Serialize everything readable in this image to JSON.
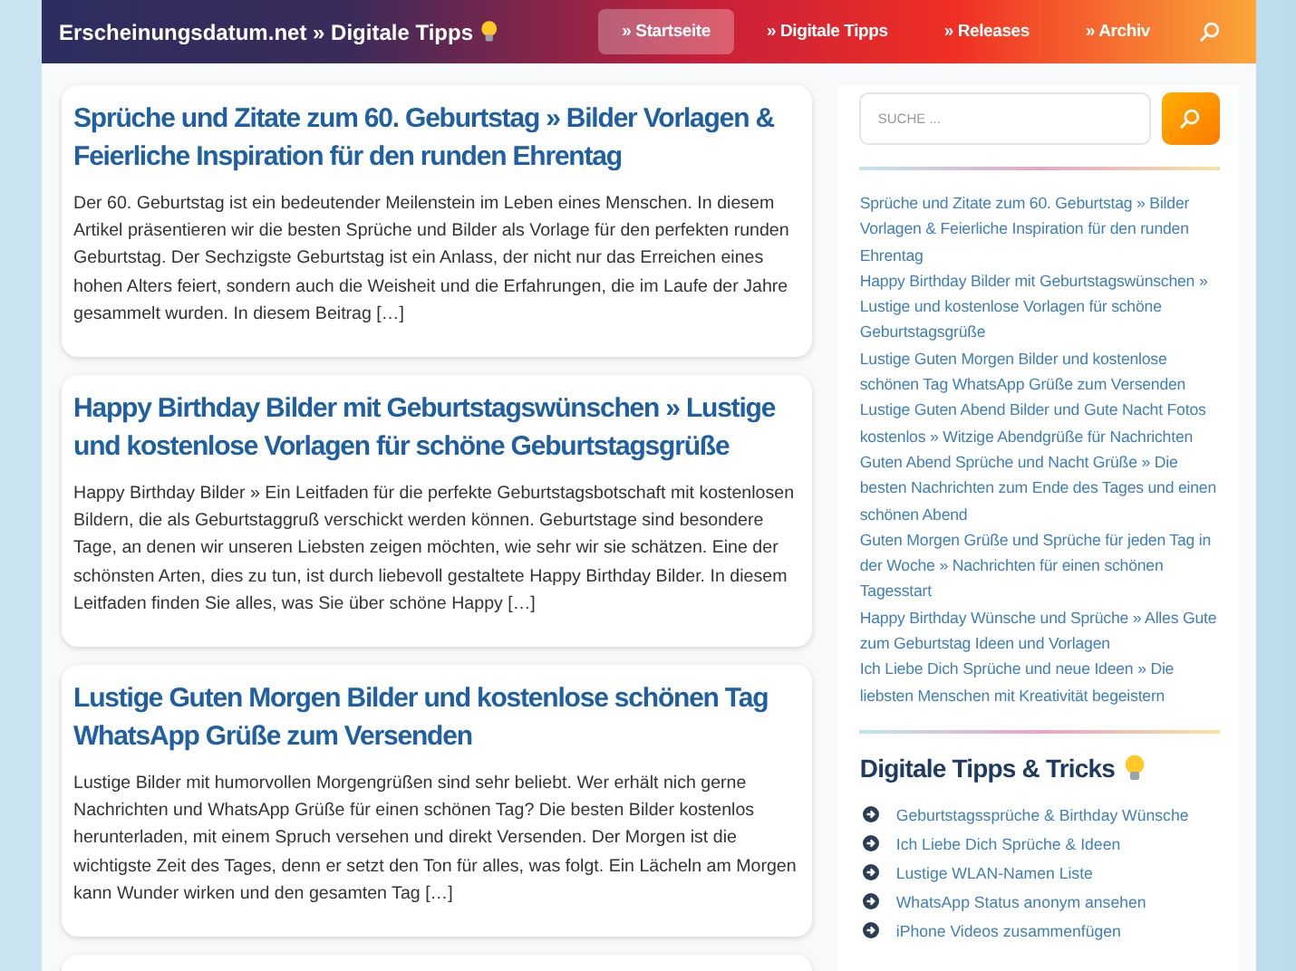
{
  "header": {
    "site_title": "Erscheinungsdatum.net » Digitale Tipps",
    "nav": [
      {
        "label": "» Startseite",
        "selected": true
      },
      {
        "label": "» Digitale Tipps",
        "selected": false
      },
      {
        "label": "» Releases",
        "selected": false
      },
      {
        "label": "» Archiv",
        "selected": false
      }
    ]
  },
  "posts": [
    {
      "title": "Sprüche und Zitate zum 60. Geburtstag » Bilder Vorlagen & Feierliche Inspiration für den runden Ehrentag",
      "excerpt": "Der 60. Geburtstag ist ein bedeutender Meilenstein im Leben eines Menschen. In diesem Artikel präsentieren wir die besten Sprüche und Bilder als Vorlage für den perfekten runden Geburtstag. Der Sechzigste Geburtstag ist ein Anlass, der nicht nur das Erreichen eines hohen Alters feiert, sondern auch die Weisheit und die Erfahrungen, die im Laufe der Jahre gesammelt wurden. In diesem Beitrag […]"
    },
    {
      "title": "Happy Birthday Bilder mit Geburtstagswünschen » Lustige und kostenlose Vorlagen für schöne Geburtstagsgrüße",
      "excerpt": "Happy Birthday Bilder » Ein Leitfaden für die perfekte Geburtstagsbotschaft mit kostenlosen Bildern, die als Geburtstaggruß verschickt werden können. Geburtstage sind besondere Tage, an denen wir unseren Liebsten zeigen möchten, wie sehr wir sie schätzen. Eine der schönsten Arten, dies zu tun, ist durch liebevoll gestaltete Happy Birthday Bilder. In diesem Leitfaden finden Sie alles, was Sie über schöne Happy […]"
    },
    {
      "title": "Lustige Guten Morgen Bilder und kostenlose schönen Tag WhatsApp Grüße zum Versenden",
      "excerpt": "Lustige Bilder mit humorvollen Morgengrüßen sind sehr beliebt. Wer erhält nich gerne Nachrichten und WhatsApp Grüße für einen schönen Tag? Die besten Bilder kostenlos herunterladen, mit einem Spruch versehen und direkt Versenden. Der Morgen ist die wichtigste Zeit des Tages, denn er setzt den Ton für alles, was folgt. Ein Lächeln am Morgen kann Wunder wirken und den gesamten Tag […]"
    }
  ],
  "sidebar": {
    "search": {
      "placeholder": "SUCHE ..."
    },
    "recent_posts": [
      "Sprüche und Zitate zum 60. Geburtstag » Bilder Vorlagen & Feierliche Inspiration für den runden Ehrentag",
      "Happy Birthday Bilder mit Geburtstagswünschen » Lustige und kostenlose Vorlagen für schöne Geburtstagsgrüße",
      "Lustige Guten Morgen Bilder und kostenlose schönen Tag WhatsApp Grüße zum Versenden",
      "Lustige Guten Abend Bilder und Gute Nacht Fotos kostenlos » Witzige Abendgrüße für Nachrichten",
      "Guten Abend Sprüche und Nacht Grüße » Die besten Nachrichten zum Ende des Tages und einen schönen Abend",
      "Guten Morgen Grüße und Sprüche für jeden Tag in der Woche » Nachrichten für einen schönen Tagesstart",
      "Happy Birthday Wünsche und Sprüche » Alles Gute zum Geburtstag Ideen und Vorlagen",
      "Ich Liebe Dich Sprüche und neue Ideen » Die liebsten Menschen mit Kreativität begeistern"
    ],
    "tips_title": "Digitale Tipps & Tricks",
    "tips": [
      "Geburtstagssprüche & Birthday Wünsche",
      "Ich Liebe Dich Sprüche & Ideen",
      "Lustige WLAN-Namen Liste",
      "WhatsApp Status anonym ansehen",
      "iPhone Videos zusammenfügen"
    ]
  }
}
